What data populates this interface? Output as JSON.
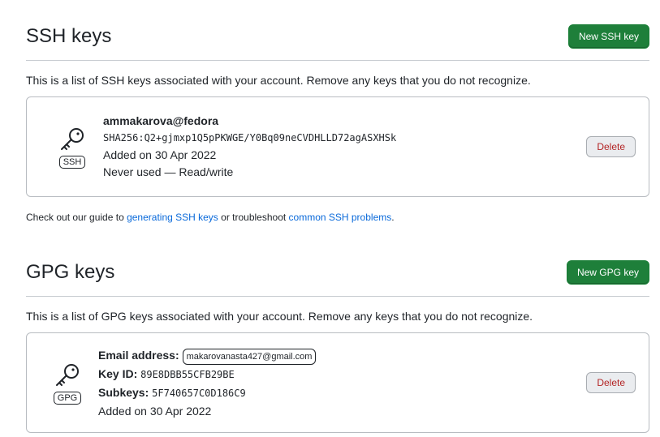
{
  "ssh": {
    "title": "SSH keys",
    "new_button": "New SSH key",
    "intro": "This is a list of SSH keys associated with your account. Remove any keys that you do not recognize.",
    "key": {
      "name": "ammakarova@fedora",
      "fingerprint": "SHA256:Q2+gjmxp1Q5pPKWGE/Y0Bq09neCVDHLLD72agASXHSk",
      "added": "Added on 30 Apr 2022",
      "usage": "Never used — Read/write",
      "label": "SSH",
      "delete_label": "Delete"
    },
    "guide": {
      "prefix": "Check out our guide to ",
      "link1": "generating SSH keys",
      "middle": " or troubleshoot ",
      "link2": "common SSH problems",
      "suffix": "."
    }
  },
  "gpg": {
    "title": "GPG keys",
    "new_button": "New GPG key",
    "intro": "This is a list of GPG keys associated with your account. Remove any keys that you do not recognize.",
    "key": {
      "email_label": "Email address:",
      "email": "makarovanasta427@gmail.com",
      "keyid_label": "Key ID:",
      "keyid": "89E8DBB55CFB29BE",
      "subkeys_label": "Subkeys:",
      "subkeys": "5F740657C0D186C9",
      "added": "Added on 30 Apr 2022",
      "label": "GPG",
      "delete_label": "Delete"
    }
  },
  "icons": {
    "key": "key-icon"
  }
}
